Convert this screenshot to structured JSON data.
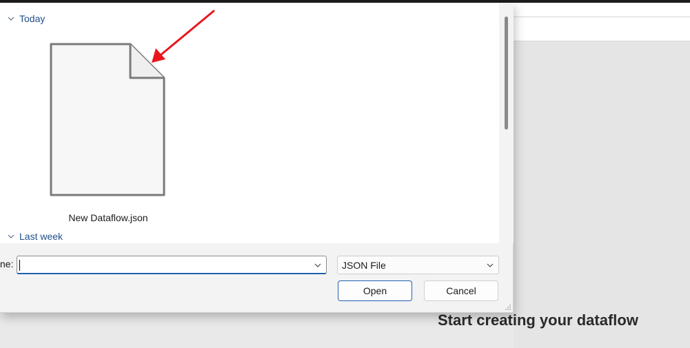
{
  "dialog": {
    "groups": [
      {
        "label": "Today"
      },
      {
        "label": "Last week"
      }
    ],
    "files": [
      {
        "name": "New Dataflow.json",
        "icon": "blank-document-icon"
      }
    ],
    "file_name": {
      "label": "ne:",
      "value": ""
    },
    "file_type": {
      "selected": "JSON File"
    },
    "buttons": {
      "open": "Open",
      "cancel": "Cancel"
    }
  },
  "background_app": {
    "empty_state_title": "Start creating your dataflow"
  },
  "annotation": {
    "color": "#e8161c",
    "icon": "red-arrow-annotation"
  },
  "colors": {
    "accent": "#1f5fad",
    "group_heading": "#1f4e8c"
  }
}
